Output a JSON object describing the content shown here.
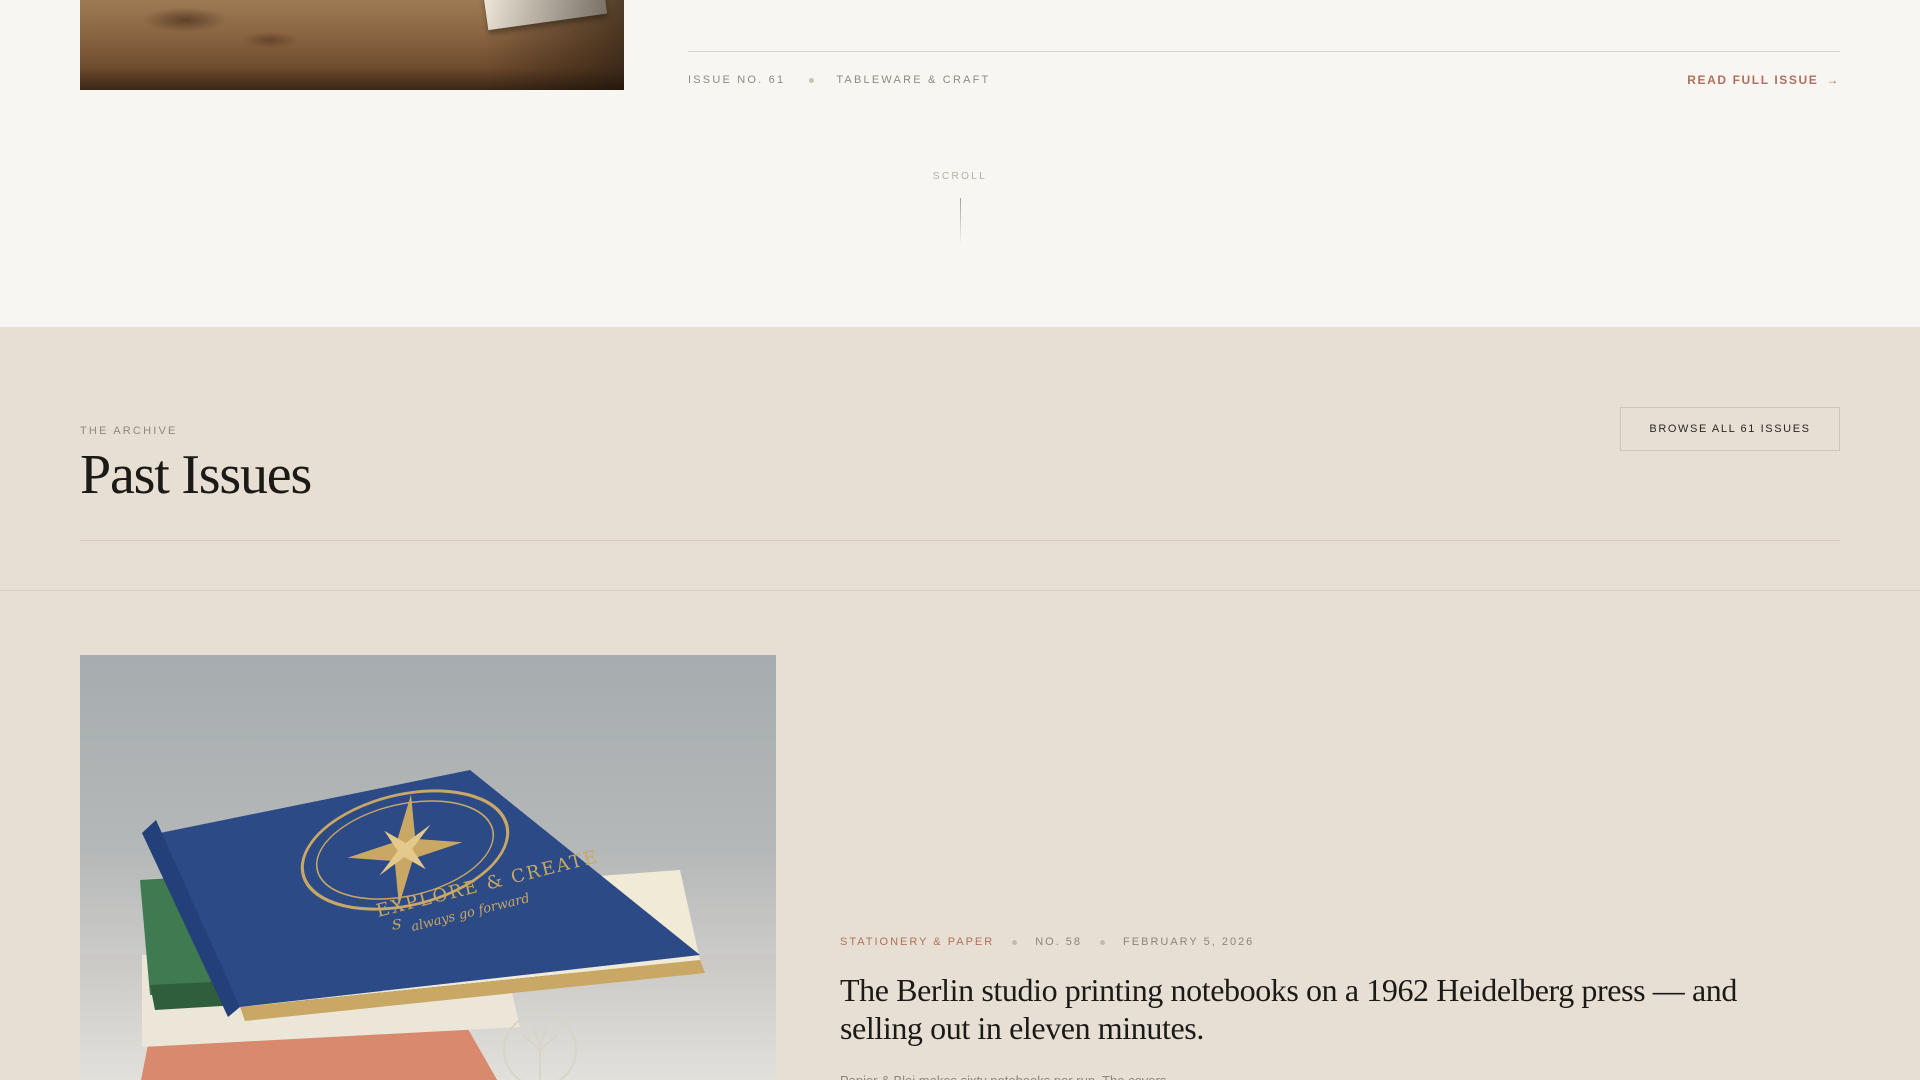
{
  "top_feature": {
    "issue_label": "ISSUE NO. 61",
    "category": "TABLEWARE & CRAFT",
    "read_link": "READ FULL ISSUE",
    "read_arrow": "→"
  },
  "scroll_cue": "SCROLL",
  "archive": {
    "eyebrow": "THE ARCHIVE",
    "title": "Past Issues",
    "browse_button": "BROWSE ALL 61 ISSUES",
    "card": {
      "category": "STATIONERY & PAPER",
      "issue": "NO. 58",
      "date": "FEBRUARY 5, 2026",
      "headline": "The Berlin studio printing notebooks on a 1962 Heidelberg press — and selling out in eleven minutes.",
      "excerpt": "Papier & Blei makes sixty notebooks per run. The covers",
      "image_cover_text": "EXPLORE & CREATE",
      "image_cover_script": "always go forward",
      "image_compass_letter": "S"
    }
  },
  "colors": {
    "background": "#f8f6f2",
    "archive_background": "#e7dfd4",
    "accent": "#b0705a",
    "notebook_blue": "#2c4a86",
    "notebook_green": "#3f7a50",
    "gold": "#c9a764"
  }
}
